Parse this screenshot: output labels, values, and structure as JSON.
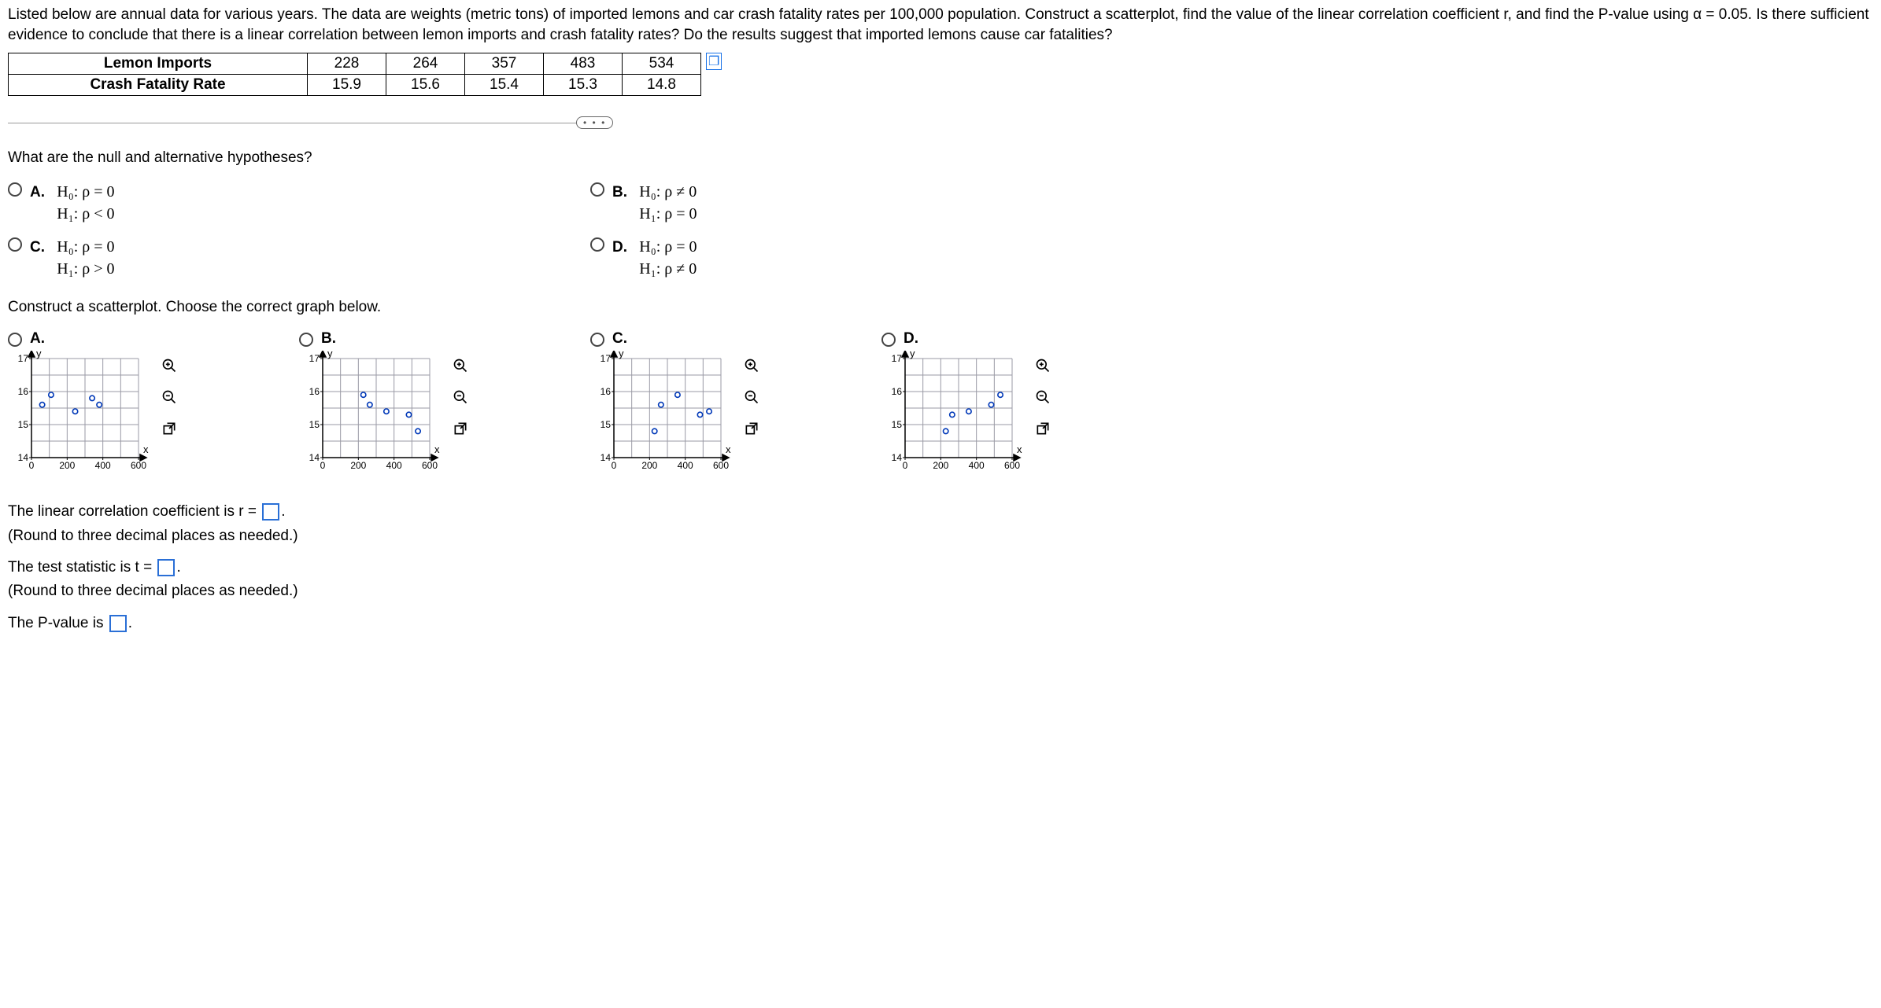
{
  "problem_text": "Listed below are annual data for various years. The data are weights (metric tons) of imported lemons and car crash fatality rates per 100,000 population. Construct a scatterplot, find the value of the linear correlation coefficient r, and find the P-value using α = 0.05. Is there sufficient evidence to conclude that there is a linear correlation between lemon imports and crash fatality rates? Do the results suggest that imported lemons cause car fatalities?",
  "table": {
    "rows": [
      {
        "label": "Lemon Imports",
        "values": [
          "228",
          "264",
          "357",
          "483",
          "534"
        ]
      },
      {
        "label": "Crash Fatality Rate",
        "values": [
          "15.9",
          "15.6",
          "15.4",
          "15.3",
          "14.8"
        ]
      }
    ]
  },
  "ellipsis": "• • •",
  "q1": {
    "prompt": "What are the null and alternative hypotheses?",
    "options": {
      "A": {
        "h0": "H₀: ρ = 0",
        "h1": "H₁: ρ < 0"
      },
      "B": {
        "h0": "H₀: ρ ≠ 0",
        "h1": "H₁: ρ = 0"
      },
      "C": {
        "h0": "H₀: ρ = 0",
        "h1": "H₁: ρ > 0"
      },
      "D": {
        "h0": "H₀: ρ = 0",
        "h1": "H₁: ρ ≠ 0"
      }
    }
  },
  "q2": {
    "prompt": "Construct a scatterplot. Choose the correct graph below.",
    "labels": {
      "A": "A.",
      "B": "B.",
      "C": "C.",
      "D": "D."
    },
    "axis": {
      "x_ticks": [
        "0",
        "200",
        "400",
        "600"
      ],
      "y_ticks": [
        "14",
        "15",
        "16",
        "17"
      ],
      "x_axis_label": "x",
      "y_axis_label": "y"
    }
  },
  "chart_data": [
    {
      "type": "scatter",
      "name": "A",
      "xlabel": "x",
      "ylabel": "y",
      "xlim": [
        0,
        600
      ],
      "ylim": [
        14,
        17
      ],
      "points": [
        {
          "x": 60,
          "y": 15.6
        },
        {
          "x": 110,
          "y": 15.9
        },
        {
          "x": 245,
          "y": 15.4
        },
        {
          "x": 340,
          "y": 15.8
        },
        {
          "x": 380,
          "y": 15.6
        }
      ]
    },
    {
      "type": "scatter",
      "name": "B",
      "xlabel": "x",
      "ylabel": "y",
      "xlim": [
        0,
        600
      ],
      "ylim": [
        14,
        17
      ],
      "points": [
        {
          "x": 228,
          "y": 15.9
        },
        {
          "x": 264,
          "y": 15.6
        },
        {
          "x": 357,
          "y": 15.4
        },
        {
          "x": 483,
          "y": 15.3
        },
        {
          "x": 534,
          "y": 14.8
        }
      ]
    },
    {
      "type": "scatter",
      "name": "C",
      "xlabel": "x",
      "ylabel": "y",
      "xlim": [
        0,
        600
      ],
      "ylim": [
        14,
        17
      ],
      "points": [
        {
          "x": 228,
          "y": 14.8
        },
        {
          "x": 264,
          "y": 15.6
        },
        {
          "x": 357,
          "y": 15.9
        },
        {
          "x": 483,
          "y": 15.3
        },
        {
          "x": 534,
          "y": 15.4
        }
      ]
    },
    {
      "type": "scatter",
      "name": "D",
      "xlabel": "x",
      "ylabel": "y",
      "xlim": [
        0,
        600
      ],
      "ylim": [
        14,
        17
      ],
      "points": [
        {
          "x": 228,
          "y": 14.8
        },
        {
          "x": 264,
          "y": 15.3
        },
        {
          "x": 357,
          "y": 15.4
        },
        {
          "x": 483,
          "y": 15.6
        },
        {
          "x": 534,
          "y": 15.9
        }
      ]
    }
  ],
  "inputs": {
    "r_label_pre": "The linear correlation coefficient is r =",
    "r_label_post": ".",
    "r_hint": "(Round to three decimal places as needed.)",
    "t_label_pre": "The test statistic is t =",
    "t_label_post": ".",
    "t_hint": "(Round to three decimal places as needed.)",
    "p_label_pre": "The P-value is",
    "p_label_post": "."
  }
}
